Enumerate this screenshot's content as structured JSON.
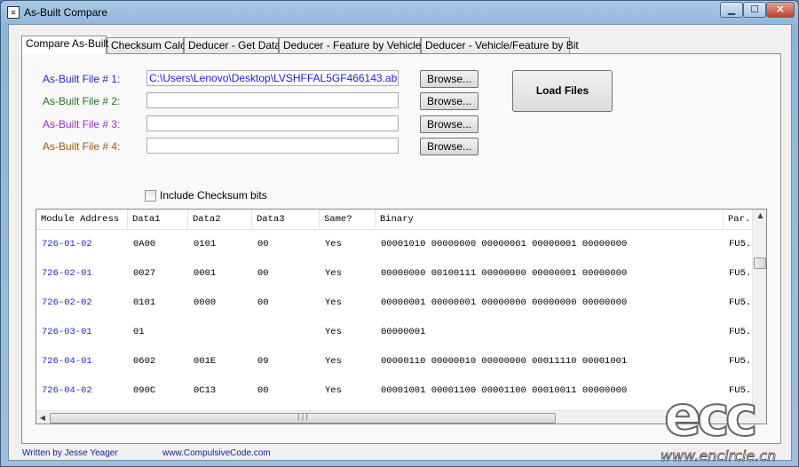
{
  "window": {
    "title": "As-Built Compare",
    "app_icon": "app-icon",
    "controls": {
      "min": "▁",
      "max": "☐",
      "close": "✕"
    }
  },
  "tabs": [
    {
      "label": "Compare As-Built",
      "active": true
    },
    {
      "label": "Checksum Calc",
      "active": false
    },
    {
      "label": "Deducer - Get Data",
      "active": false
    },
    {
      "label": "Deducer - Feature by Vehicles",
      "active": false
    },
    {
      "label": "Deducer - Vehicle/Feature by Bit",
      "active": false
    }
  ],
  "files": [
    {
      "label": "As-Built File # 1:",
      "value": "C:\\Users\\Lenovo\\Desktop\\LVSHFFAL5GF466143.ab",
      "color": "#1f2bc4",
      "browse": "Browse..."
    },
    {
      "label": "As-Built File # 2:",
      "value": "",
      "color": "#1a7a1a",
      "browse": "Browse..."
    },
    {
      "label": "As-Built File # 3:",
      "value": "",
      "color": "#9b30c8",
      "browse": "Browse..."
    },
    {
      "label": "As-Built File # 4:",
      "value": "",
      "color": "#9a5a1a",
      "browse": "Browse..."
    }
  ],
  "load_button": "Load Files",
  "include_checksum": {
    "label": "Include Checksum bits",
    "checked": false
  },
  "grid": {
    "columns": [
      "Module Address",
      "Data1",
      "Data2",
      "Data3",
      "Same?",
      "Binary",
      "Par."
    ],
    "rows": [
      {
        "address": "726-01-02",
        "data1": "0A00",
        "data2": "0101",
        "data3": "00",
        "same": "Yes",
        "binary": "00001010 00000000 00000001 00000001 00000000",
        "par": "FU5."
      },
      {
        "address": "726-02-01",
        "data1": "0027",
        "data2": "0001",
        "data3": "00",
        "same": "Yes",
        "binary": "00000000 00100111 00000000 00000001 00000000",
        "par": "FU5."
      },
      {
        "address": "726-02-02",
        "data1": "0101",
        "data2": "0000",
        "data3": "00",
        "same": "Yes",
        "binary": "00000001 00000001 00000000 00000000 00000000",
        "par": "FU5."
      },
      {
        "address": "726-03-01",
        "data1": "01",
        "data2": "",
        "data3": "",
        "same": "Yes",
        "binary": "00000001",
        "par": "FU5."
      },
      {
        "address": "726-04-01",
        "data1": "0602",
        "data2": "001E",
        "data3": "09",
        "same": "Yes",
        "binary": "00000110 00000010 00000000 00011110 00001001",
        "par": "FU5."
      },
      {
        "address": "726-04-02",
        "data1": "090C",
        "data2": "0C13",
        "data3": "00",
        "same": "Yes",
        "binary": "00001001 00001100 00001100 00010011 00000000",
        "par": "FU5."
      }
    ]
  },
  "footer": {
    "author": "Written by Jesse Yeager",
    "website": "www.CompulsiveCode.com"
  },
  "watermark": {
    "logo": "ecc",
    "url": "www.encircle.cn"
  }
}
